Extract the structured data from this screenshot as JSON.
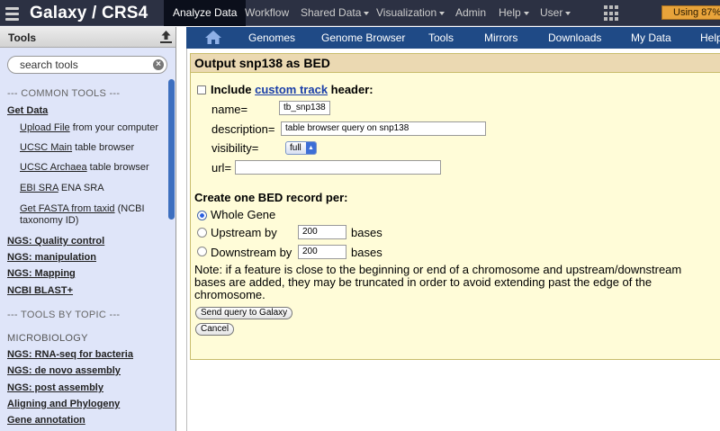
{
  "masthead": {
    "brand": "Galaxy / CRS4",
    "tabs": [
      {
        "label": "Analyze Data",
        "active": true
      },
      {
        "label": "Workflow"
      },
      {
        "label": "Shared Data",
        "dropdown": true
      },
      {
        "label": "Visualization",
        "dropdown": true
      },
      {
        "label": "Admin"
      },
      {
        "label": "Help",
        "dropdown": true
      },
      {
        "label": "User",
        "dropdown": true
      }
    ],
    "quota": "Using 87%"
  },
  "tool_panel": {
    "header": "Tools",
    "search_placeholder": "search tools",
    "items": [
      {
        "text": "--- COMMON TOOLS ---",
        "kind": "section"
      },
      {
        "text": "Get Data",
        "kind": "group"
      },
      {
        "link": "Upload File",
        "rest": " from your computer",
        "kind": "tool"
      },
      {
        "link": "UCSC Main",
        "rest": " table browser",
        "kind": "tool"
      },
      {
        "link": "UCSC Archaea",
        "rest": " table browser",
        "kind": "tool"
      },
      {
        "link": "EBI SRA",
        "rest": " ENA SRA",
        "kind": "tool"
      },
      {
        "link": "Get FASTA from taxid",
        "rest": " (NCBI",
        "kind": "tool"
      },
      {
        "text": "taxonomy ID)",
        "kind": "tool-cont"
      },
      {
        "text": "NGS: Quality control",
        "kind": "group"
      },
      {
        "text": "NGS: manipulation",
        "kind": "group"
      },
      {
        "text": "NGS: Mapping",
        "kind": "group"
      },
      {
        "text": "NCBI BLAST+",
        "kind": "group"
      },
      {
        "text": "--- TOOLS BY TOPIC ---",
        "kind": "section"
      },
      {
        "text": "MICROBIOLOGY",
        "kind": "category"
      },
      {
        "text": "NGS: RNA-seq for bacteria",
        "kind": "group"
      },
      {
        "text": "NGS: de novo assembly",
        "kind": "group"
      },
      {
        "text": "NGS: post assembly",
        "kind": "group"
      },
      {
        "text": "Aligning and Phylogeny",
        "kind": "group"
      },
      {
        "text": "Gene annotation",
        "kind": "group"
      }
    ]
  },
  "center_nav": {
    "items": [
      "Genomes",
      "Genome Browser",
      "Tools",
      "Mirrors",
      "Downloads",
      "My Data",
      "Help"
    ]
  },
  "form": {
    "title": "Output snp138 as BED",
    "include_prefix": "Include ",
    "include_link": "custom track",
    "include_suffix": " header:",
    "name_label": "name=",
    "name_value": "tb_snp138",
    "description_label": "description=",
    "description_value": "table browser query on snp138",
    "visibility_label": "visibility=",
    "visibility_value": "full",
    "url_label": "url=",
    "url_value": "",
    "record_heading": "Create one BED record per:",
    "opt_whole_gene": "Whole Gene",
    "opt_upstream": "Upstream by",
    "upstream_value": "200",
    "opt_downstream": "Downstream by",
    "downstream_value": "200",
    "bases_label": "bases",
    "note": "Note: if a feature is close to the beginning or end of a chromosome and upstream/downstream bases are added, they may be truncated in order to avoid extending past the edge of the chromosome.",
    "send_button": "Send query to Galaxy",
    "cancel_button": "Cancel"
  }
}
